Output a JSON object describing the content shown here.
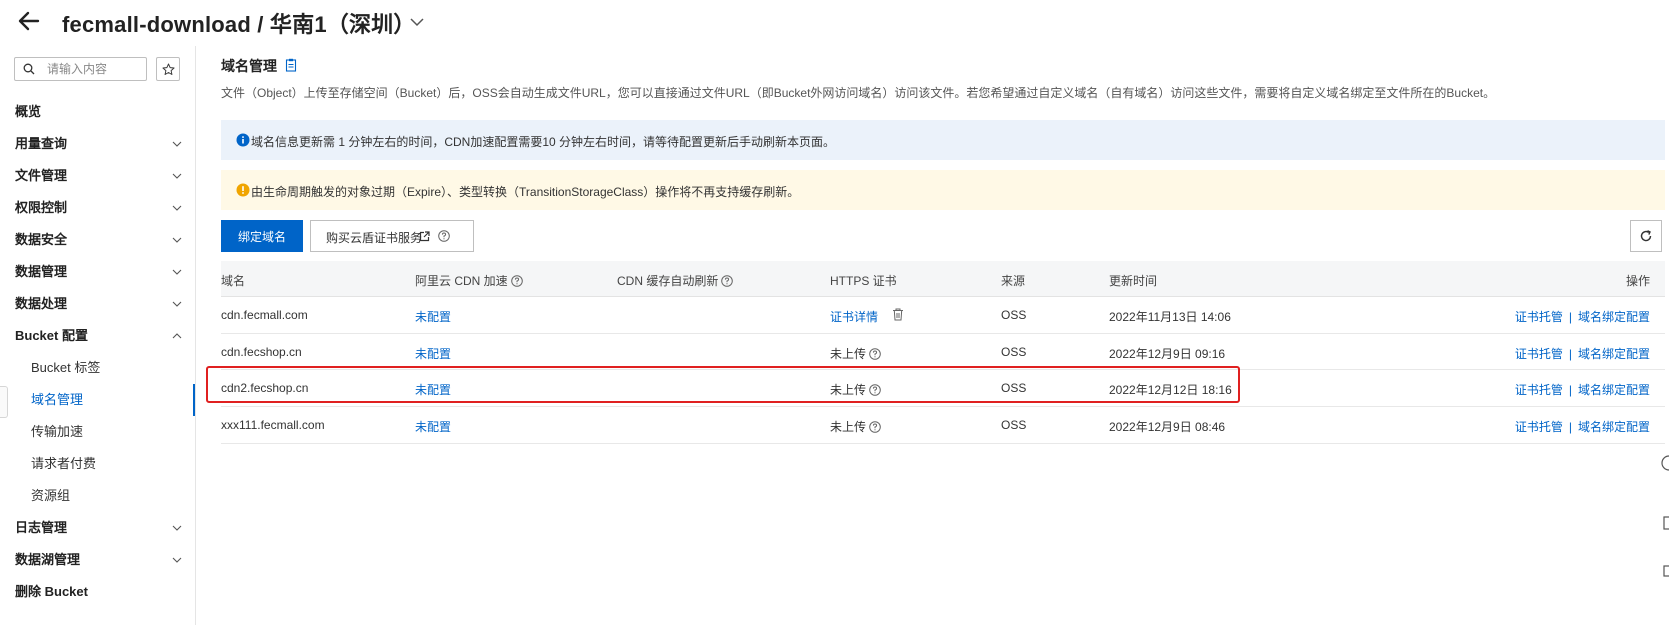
{
  "header": {
    "title": "fecmall-download / 华南1（深圳）"
  },
  "sidebar": {
    "search_placeholder": "请输入内容",
    "items": [
      {
        "label": "概览",
        "has_chevron": false,
        "sub": false
      },
      {
        "label": "用量查询",
        "has_chevron": true,
        "sub": false
      },
      {
        "label": "文件管理",
        "has_chevron": true,
        "sub": false
      },
      {
        "label": "权限控制",
        "has_chevron": true,
        "sub": false
      },
      {
        "label": "数据安全",
        "has_chevron": true,
        "sub": false
      },
      {
        "label": "数据管理",
        "has_chevron": true,
        "sub": false
      },
      {
        "label": "数据处理",
        "has_chevron": true,
        "sub": false
      },
      {
        "label": "Bucket 配置",
        "has_chevron": true,
        "expanded": true,
        "sub": false
      },
      {
        "label": "Bucket 标签",
        "sub": true
      },
      {
        "label": "域名管理",
        "sub": true,
        "active": true
      },
      {
        "label": "传输加速",
        "sub": true
      },
      {
        "label": "请求者付费",
        "sub": true
      },
      {
        "label": "资源组",
        "sub": true
      },
      {
        "label": "日志管理",
        "has_chevron": true,
        "sub": false
      },
      {
        "label": "数据湖管理",
        "has_chevron": true,
        "sub": false
      },
      {
        "label": "删除 Bucket",
        "has_chevron": false,
        "sub": false
      }
    ]
  },
  "main": {
    "title": "域名管理",
    "description": "文件（Object）上传至存储空间（Bucket）后，OSS会自动生成文件URL，您可以直接通过文件URL（即Bucket外网访问域名）访问该文件。若您希望通过自定义域名（自有域名）访问这些文件，需要将自定义域名绑定至文件所在的Bucket。",
    "info_alert": "域名信息更新需 1 分钟左右的时间，CDN加速配置需要10 分钟左右时间，请等待配置更新后手动刷新本页面。",
    "warn_alert": "由生命周期触发的对象过期（Expire）、类型转换（TransitionStorageClass）操作将不再支持缓存刷新。",
    "bind_button": "绑定域名",
    "buy_cert_button": "购买云盾证书服务",
    "colors": {
      "primary": "#0064c8",
      "info_bg": "#ebf2fa",
      "warn_bg": "#fff9e6",
      "highlight": "#e02020"
    }
  },
  "table": {
    "headers": {
      "domain": "域名",
      "cdn": "阿里云 CDN 加速",
      "cdn_refresh": "CDN 缓存自动刷新",
      "https": "HTTPS 证书",
      "source": "来源",
      "updated": "更新时间",
      "actions": "操作"
    },
    "rows": [
      {
        "domain": "cdn.fecmall.com",
        "cdn": "未配置",
        "https": "证书详情",
        "https_link": true,
        "source": "OSS",
        "updated": "2022年11月13日 14:06",
        "action1": "证书托管",
        "action2": "域名绑定配置"
      },
      {
        "domain": "cdn.fecshop.cn",
        "cdn": "未配置",
        "https": "未上传",
        "https_link": false,
        "source": "OSS",
        "updated": "2022年12月9日 09:16",
        "action1": "证书托管",
        "action2": "域名绑定配置"
      },
      {
        "domain": "cdn2.fecshop.cn",
        "cdn": "未配置",
        "https": "未上传",
        "https_link": false,
        "source": "OSS",
        "updated": "2022年12月12日 18:16",
        "action1": "证书托管",
        "action2": "域名绑定配置"
      },
      {
        "domain": "xxx111.fecmall.com",
        "cdn": "未配置",
        "https": "未上传",
        "https_link": false,
        "source": "OSS",
        "updated": "2022年12月9日 08:46",
        "action1": "证书托管",
        "action2": "域名绑定配置"
      }
    ],
    "action_separator": "|"
  }
}
